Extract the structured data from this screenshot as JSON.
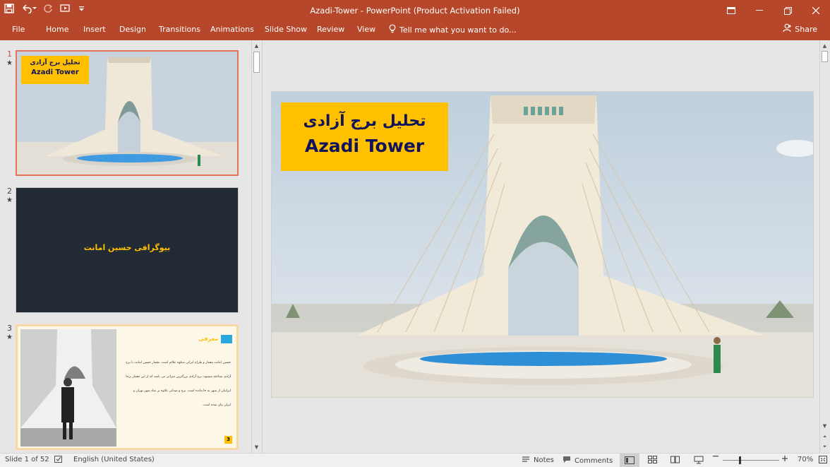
{
  "window": {
    "title": "Azadi-Tower - PowerPoint (Product Activation Failed)",
    "accent": "#b7472a"
  },
  "ribbon": {
    "tabs": [
      "File",
      "Home",
      "Insert",
      "Design",
      "Transitions",
      "Animations",
      "Slide Show",
      "Review",
      "View"
    ],
    "tell_me": "Tell me what you want to do...",
    "share": "Share"
  },
  "thumbnails": [
    {
      "number": "1",
      "title_fa": "تحلیل برج آزادی",
      "title_en": "Azadi Tower"
    },
    {
      "number": "2",
      "title_fa": "بیوگرافی حسین امانت"
    },
    {
      "number": "3",
      "heading": "معرفی",
      "lines": [
        "حسین امانت معمار و طراح ایرانی شکوه علائم است. معمار حسین امانت با برج",
        "آزادی شناخته میشود، برج آزادی بزرگترین میراثی می باشد که از این معمار برجا",
        "ایرانیان از شهر به جا مانده است. برج و میدانی علاوه بر نماد شهر تهران و",
        "ایران بیان شده است."
      ],
      "page_badge": "3"
    }
  ],
  "main_slide": {
    "title_fa": "تحلیل برج آزادی",
    "title_en": "Azadi Tower"
  },
  "status": {
    "slide_position": "Slide 1 of 52",
    "language": "English (United States)",
    "notes": "Notes",
    "comments": "Comments",
    "zoom": "70%"
  },
  "colors": {
    "title_box": "#ffc000",
    "title_text": "#10135c",
    "dark_slide": "#222a35",
    "dark_slide_text": "#ffc000",
    "selection": "#e8735c"
  }
}
